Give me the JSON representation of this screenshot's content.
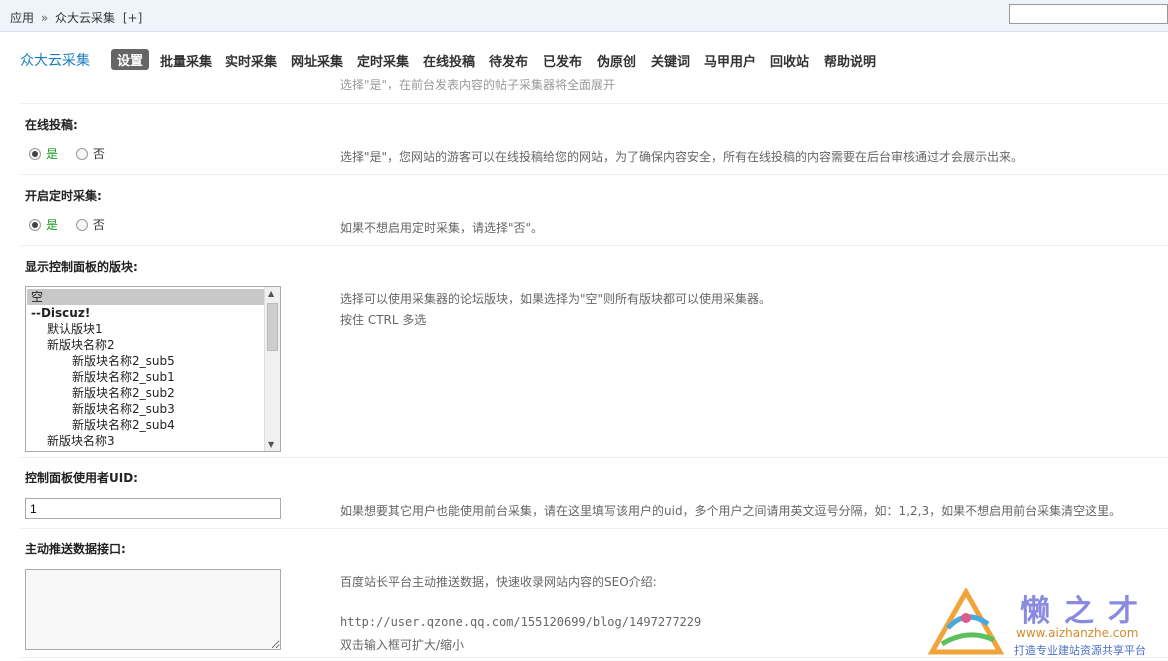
{
  "topbar": {
    "crumb_root": "应用",
    "crumb_sep": "»",
    "crumb_current": "众大云采集",
    "crumb_add": "[+]"
  },
  "nav": {
    "brand": "众大云采集",
    "items": [
      "设置",
      "批量采集",
      "实时采集",
      "网址采集",
      "定时采集",
      "在线投稿",
      "待发布",
      "已发布",
      "伪原创",
      "关键词",
      "马甲用户",
      "回收站",
      "帮助说明"
    ],
    "active_index": 0
  },
  "sections": {
    "prev_tip": "选择\"是\"，在前台发表内容的帖子采集器将全面展开",
    "online_submit": {
      "label": "在线投稿:",
      "yes": "是",
      "no": "否",
      "selected": "是",
      "tip": "选择\"是\"，您网站的游客可以在线投稿给您的网站，为了确保内容安全，所有在线投稿的内容需要在后台审核通过才会展示出来。"
    },
    "timed_collect": {
      "label": "开启定时采集:",
      "yes": "是",
      "no": "否",
      "selected": "是",
      "tip": "如果不想启用定时采集，请选择\"否\"。"
    },
    "forums": {
      "label": "显示控制面板的版块:",
      "options": [
        {
          "text": "空",
          "indent": 0,
          "selected": true,
          "bold": false
        },
        {
          "text": "--Discuz!",
          "indent": 0,
          "selected": false,
          "bold": true
        },
        {
          "text": "默认版块1",
          "indent": 1,
          "selected": false,
          "bold": false
        },
        {
          "text": "新版块名称2",
          "indent": 1,
          "selected": false,
          "bold": false
        },
        {
          "text": "新版块名称2_sub5",
          "indent": 2,
          "selected": false,
          "bold": false
        },
        {
          "text": "新版块名称2_sub1",
          "indent": 2,
          "selected": false,
          "bold": false
        },
        {
          "text": "新版块名称2_sub2",
          "indent": 2,
          "selected": false,
          "bold": false
        },
        {
          "text": "新版块名称2_sub3",
          "indent": 2,
          "selected": false,
          "bold": false
        },
        {
          "text": "新版块名称2_sub4",
          "indent": 2,
          "selected": false,
          "bold": false
        },
        {
          "text": "新版块名称3",
          "indent": 1,
          "selected": false,
          "bold": false
        }
      ],
      "tip_line1": "选择可以使用采集器的论坛版块，如果选择为\"空\"则所有版块都可以使用采集器。",
      "tip_line2": "按住 CTRL 多选"
    },
    "uid": {
      "label": "控制面板使用者UID:",
      "value": "1",
      "tip": "如果想要其它用户也能使用前台采集，请在这里填写该用户的uid，多个用户之间请用英文逗号分隔，如：1,2,3，如果不想启用前台采集清空这里。"
    },
    "push": {
      "label": "主动推送数据接口:",
      "value": "",
      "tip_line1": "百度站长平台主动推送数据，快速收录网站内容的SEO介绍:",
      "tip_line2": "http://user.qzone.qq.com/155120699/blog/1497277229",
      "tip_line3": "双击输入框可扩大/缩小"
    }
  },
  "watermark": {
    "title": "懒之才",
    "url": "www.aizhanzhe.com",
    "slogan": "打造专业建站资源共享平台"
  },
  "colors": {
    "brand": "#1a7fc0",
    "radio_yes": "#1a9a1a",
    "active_tab_bg": "#666666"
  }
}
